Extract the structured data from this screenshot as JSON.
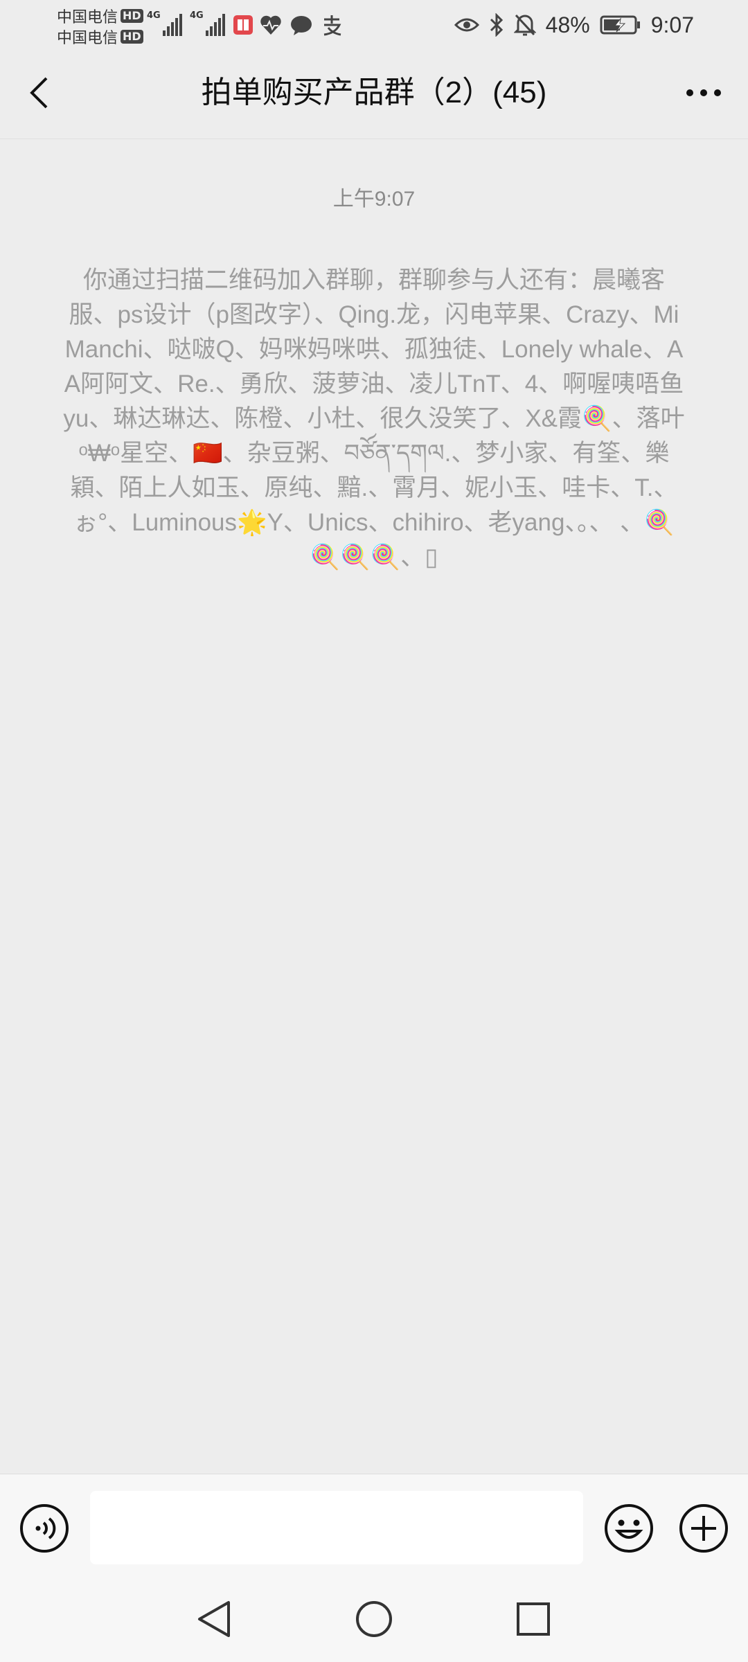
{
  "status_bar": {
    "carrier_1": "中国电信",
    "carrier_2": "中国电信",
    "hd_label": "HD",
    "network_1": "4G",
    "network_2": "4G",
    "battery_percent": "48%",
    "time": "9:07"
  },
  "header": {
    "title": "拍单购买产品群（2）(45)"
  },
  "messages": {
    "timestamp": "上午9:07",
    "system_message": "你通过扫描二维码加入群聊，群聊参与人还有：晨曦客服、ps设计（p图改字）、Qing.龙，闪电苹果、Crazy、Mi Manchi、哒啵Q、妈咪妈咪哄、孤独徒、Lonely whale、AA阿阿文、Re.、勇欣、菠萝油、凌儿TnT、4、啊喔咦唔鱼yu、琳达琳达、陈橙、小杜、很久没笑了、X&霞🍭、落叶ᵒ₩ᵒ星空、🇨🇳、杂豆粥、བཙོན་དགལ.、梦小家、有筌、樂穎、陌上人如玉、原纯、黯.、霄月、妮小玉、哇卡、T.、ぉ°、Luminous🌟Y、Unics、chihiro、老yang、。、 、🍭🍭🍭🍭、▯"
  },
  "input_bar": {
    "text_value": ""
  },
  "icons": {
    "back": "chevron-left-icon",
    "more": "more-horizontal-icon",
    "voice": "voice-icon",
    "emoji": "emoji-icon",
    "plus": "plus-icon",
    "nav_back": "nav-back-icon",
    "nav_home": "nav-home-icon",
    "nav_recent": "nav-recent-icon"
  }
}
